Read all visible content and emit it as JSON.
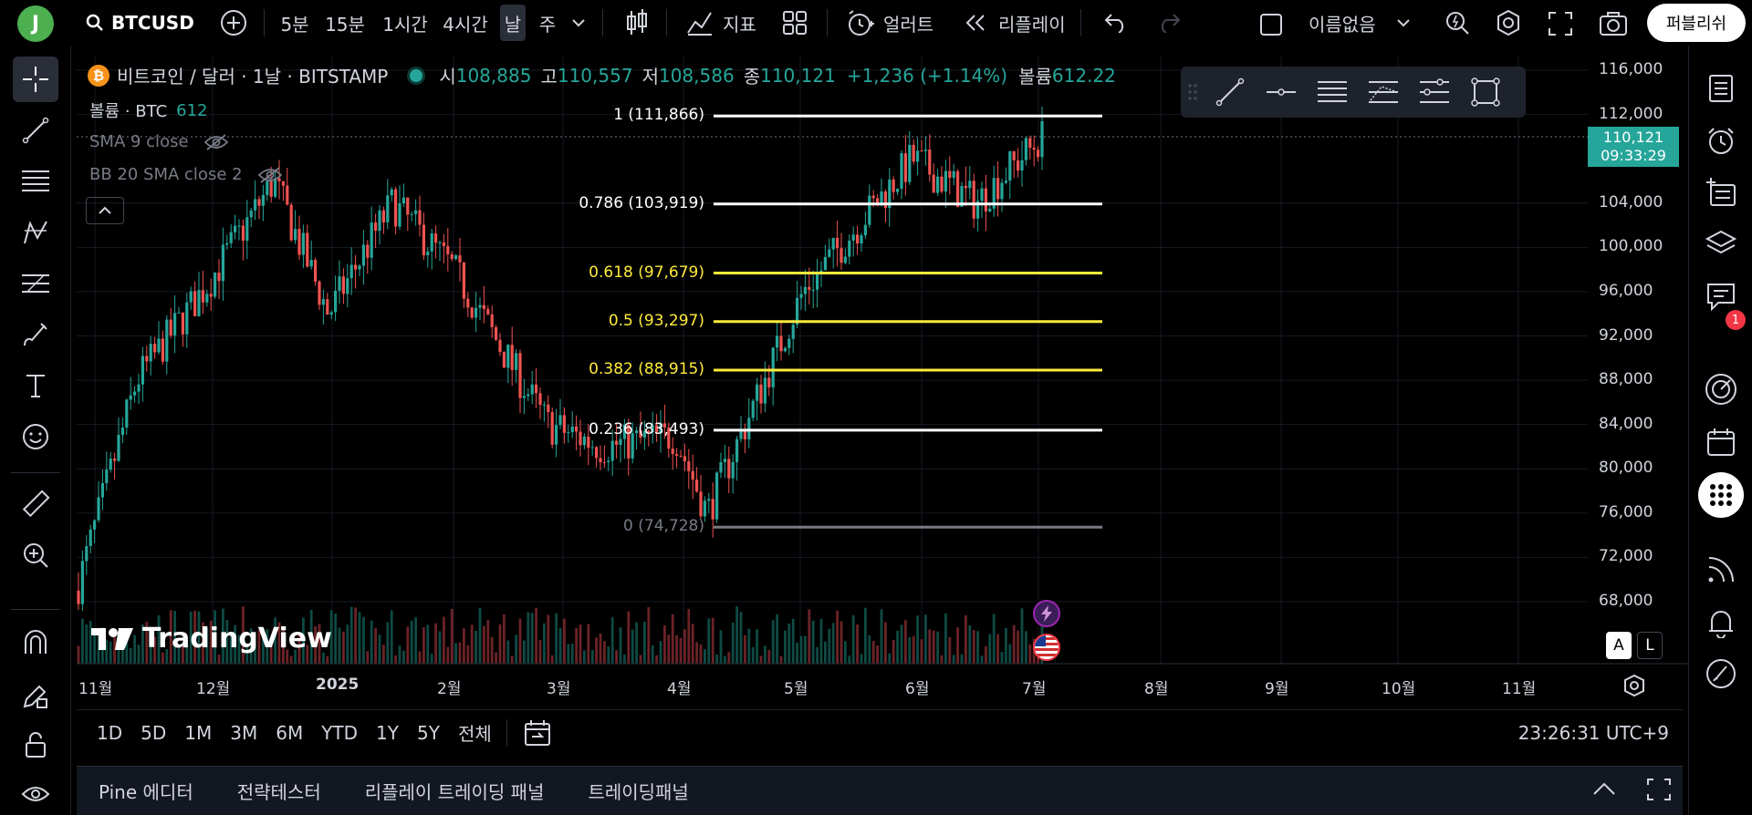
{
  "topbar": {
    "avatar_letter": "J",
    "symbol": "BTCUSD",
    "intervals": [
      "5분",
      "15분",
      "1시간",
      "4시간",
      "날",
      "주"
    ],
    "active_interval": "날",
    "indicators_label": "지표",
    "alert_label": "얼러트",
    "replay_label": "리플레이",
    "layout_name": "이름없음",
    "publish_label": "퍼블리쉬"
  },
  "legend": {
    "title": "비트코인 / 달러 · 1날 · BITSTAMP",
    "open_label": "시",
    "open": "108,885",
    "high_label": "고",
    "high": "110,557",
    "low_label": "저",
    "low": "108,586",
    "close_label": "종",
    "close": "110,121",
    "change": "+1,236 (+1.14%)",
    "volume_label": "볼륨",
    "volume": "612.22",
    "volume_indicator": "볼륨 · BTC",
    "volume_indicator_value": "612",
    "sma": "SMA 9 close",
    "bb": "BB 20 SMA close 2"
  },
  "price_axis": {
    "labels": [
      "116,000",
      "112,000",
      "104,000",
      "100,000",
      "96,000",
      "92,000",
      "88,000",
      "84,000",
      "80,000",
      "76,000",
      "72,000",
      "68,000"
    ],
    "last_price": "110,121",
    "countdown": "09:33:29"
  },
  "time_axis": {
    "labels": [
      "11월",
      "12월",
      "2025",
      "2월",
      "3월",
      "4월",
      "5월",
      "6월",
      "7월",
      "8월",
      "9월",
      "10월",
      "11월"
    ]
  },
  "fib": {
    "levels": [
      {
        "label": "1 (111,866)",
        "price": 111866,
        "color": "#ffffff"
      },
      {
        "label": "0.786 (103,919)",
        "price": 103919,
        "color": "#ffffff"
      },
      {
        "label": "0.618 (97,679)",
        "price": 97679,
        "color": "#ffeb3b"
      },
      {
        "label": "0.5 (93,297)",
        "price": 93297,
        "color": "#ffeb3b"
      },
      {
        "label": "0.382 (88,915)",
        "price": 88915,
        "color": "#ffeb3b"
      },
      {
        "label": "0.236 (83,493)",
        "price": 83493,
        "color": "#ffffff"
      },
      {
        "label": "0 (74,728)",
        "price": 74728,
        "color": "#787b86"
      }
    ]
  },
  "watermark": "TradingView",
  "scale_buttons": {
    "auto": "A",
    "log": "L"
  },
  "range_bar": {
    "ranges": [
      "1D",
      "5D",
      "1M",
      "3M",
      "6M",
      "YTD",
      "1Y",
      "5Y",
      "전체"
    ],
    "clock": "23:26:31 UTC+9"
  },
  "bottom_tabs": [
    "Pine 에디터",
    "전략테스터",
    "리플레이 트레이딩 패널",
    "트레이딩패널"
  ],
  "notifications_badge": "1",
  "chart_data": {
    "type": "candlestick",
    "title": "비트코인 / 달러 · 1날 · BITSTAMP",
    "ylim": [
      66000,
      118000
    ],
    "x_months": [
      "11월",
      "12월",
      "2025",
      "2월",
      "3월",
      "4월",
      "5월",
      "6월",
      "7월",
      "8월",
      "9월",
      "10월",
      "11월"
    ],
    "colors": {
      "up": "#26a69a",
      "down": "#ef5350"
    },
    "approx_close_path": [
      {
        "month": "11월 start",
        "close": 69000
      },
      {
        "month": "11월 mid",
        "close": 88000
      },
      {
        "month": "12월 start",
        "close": 97000
      },
      {
        "month": "12월 mid",
        "close": 106000
      },
      {
        "month": "2025 start",
        "close": 94000
      },
      {
        "month": "1월 mid",
        "close": 104000
      },
      {
        "month": "2월 start",
        "close": 98000
      },
      {
        "month": "2월 end",
        "close": 84000
      },
      {
        "month": "3월 mid",
        "close": 82000
      },
      {
        "month": "4월 start",
        "close": 83000
      },
      {
        "month": "4월 low",
        "close": 76000
      },
      {
        "month": "5월 start",
        "close": 96000
      },
      {
        "month": "5월 end",
        "close": 108000
      },
      {
        "month": "6월 mid",
        "close": 104000
      },
      {
        "month": "6월 end",
        "close": 107000
      },
      {
        "month": "7월 start",
        "close": 110121
      }
    ]
  }
}
